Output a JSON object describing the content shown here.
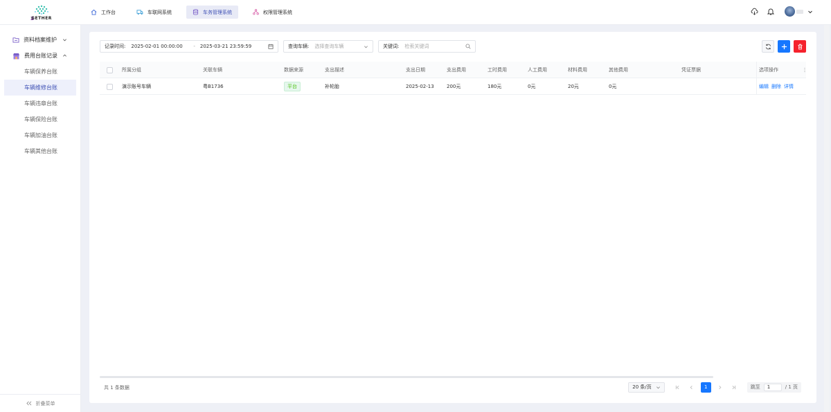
{
  "brand": {
    "logo_text": "GETHER"
  },
  "nav": [
    {
      "label": "工作台",
      "icon": "home-icon"
    },
    {
      "label": "车联网系统",
      "icon": "truck-icon"
    },
    {
      "label": "车务管理系统",
      "icon": "database-icon"
    },
    {
      "label": "权限管理系统",
      "icon": "nodes-icon"
    }
  ],
  "nav_active_index": 2,
  "sidebar": {
    "group1": "资料档案维护",
    "group2": "费用台账记录",
    "items": [
      "车辆保养台账",
      "车辆维修台账",
      "车辆违章台账",
      "车辆保险台账",
      "车辆加油台账",
      "车辆其他台账"
    ],
    "active_index": 1,
    "collapse_label": "折叠菜单"
  },
  "filters": {
    "time_label": "记录时间:",
    "time_start": "2025-02-01 00:00:00",
    "time_sep": "-",
    "time_end": "2025-03-21 23:59:59",
    "vehicle_label": "查询车辆:",
    "vehicle_placeholder": "选择查询车辆",
    "keyword_label": "关键词:",
    "keyword_placeholder": "检索关键词"
  },
  "table": {
    "headers": [
      "所属分组",
      "关联车辆",
      "数据来源",
      "支出描述",
      "支出日期",
      "支出费用",
      "工时费用",
      "人工费用",
      "材料费用",
      "其他费用",
      "凭证票据",
      "选项操作"
    ],
    "rows": [
      {
        "group": "演示账号车辆",
        "vehicle": "粤B1736",
        "source": "平台",
        "desc": "补轮胎",
        "date": "2025-02-13",
        "cost": "200元",
        "labor_hours": "180元",
        "labor": "0元",
        "material": "20元",
        "other": "0元",
        "voucher": ""
      }
    ],
    "ops": [
      "编辑",
      "删除",
      "详情"
    ]
  },
  "footer": {
    "total": "共 1 条数据",
    "page_size": "20 条/页",
    "current_page": "1",
    "jump_label": "跳至",
    "jump_value": "1",
    "page_total": "/ 1 页"
  },
  "colors": {
    "primary": "#1677ff",
    "danger": "#f5222d",
    "accent": "#3f51b5",
    "tag_green": "#52c41a"
  }
}
